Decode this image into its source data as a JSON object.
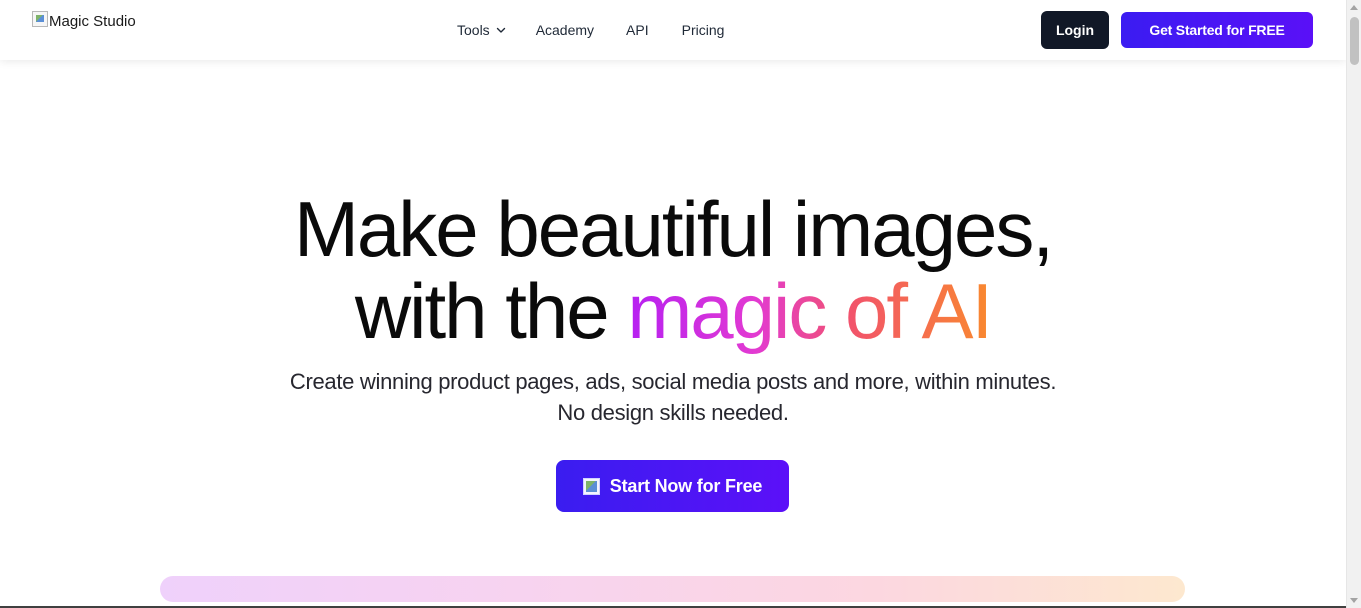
{
  "header": {
    "logo_alt": "Magic Studio",
    "nav": {
      "tools": "Tools",
      "academy": "Academy",
      "api": "API",
      "pricing": "Pricing"
    },
    "login_label": "Login",
    "cta_label": "Get Started for FREE"
  },
  "hero": {
    "title_line1": "Make beautiful images,",
    "title_line2_plain": "with the ",
    "title_line2_gradient": "magic of AI",
    "subtitle_line1": "Create winning product pages, ads, social media posts and more, within minutes.",
    "subtitle_line2": "No design skills needed.",
    "start_button_label": "Start Now for Free"
  },
  "colors": {
    "primary": "#4a16f4",
    "dark_button": "#111827",
    "gradient": [
      "#b620f2",
      "#e23ad2",
      "#f2546a",
      "#f9892f"
    ]
  },
  "icons": {
    "logo": "broken-image-icon",
    "tools_dropdown": "chevron-down-icon",
    "start_button": "broken-image-icon"
  }
}
